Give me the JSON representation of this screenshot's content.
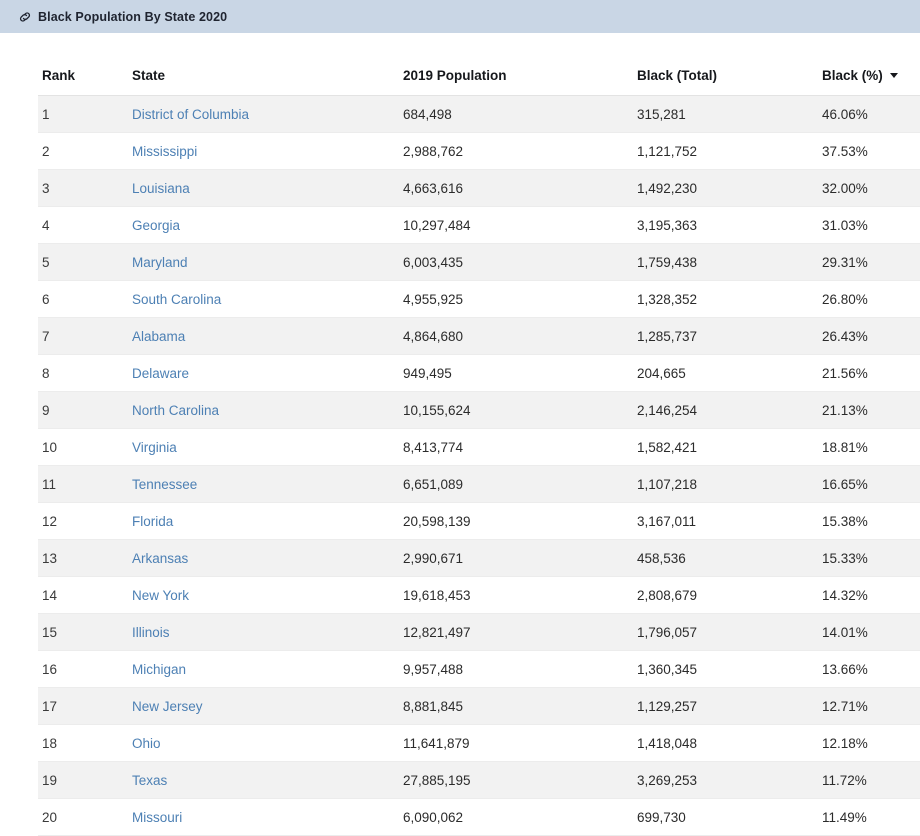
{
  "banner": {
    "icon": "link-icon",
    "title": "Black Population By State 2020",
    "background_color": "#c9d6e5"
  },
  "table": {
    "columns": [
      {
        "key": "rank",
        "label": "Rank",
        "sorted": false
      },
      {
        "key": "state",
        "label": "State",
        "sorted": false
      },
      {
        "key": "pop",
        "label": "2019 Population",
        "sorted": false
      },
      {
        "key": "total",
        "label": "Black (Total)",
        "sorted": false
      },
      {
        "key": "pct",
        "label": "Black (%)",
        "sorted": true,
        "sort_direction": "descending",
        "sort_icon": "caret-down-icon"
      }
    ],
    "link_color": "#4d80b4",
    "row_stripe_color": "#f2f2f2",
    "rows": [
      {
        "rank": "1",
        "state": "District of Columbia",
        "pop": "684,498",
        "total": "315,281",
        "pct": "46.06%"
      },
      {
        "rank": "2",
        "state": "Mississippi",
        "pop": "2,988,762",
        "total": "1,121,752",
        "pct": "37.53%"
      },
      {
        "rank": "3",
        "state": "Louisiana",
        "pop": "4,663,616",
        "total": "1,492,230",
        "pct": "32.00%"
      },
      {
        "rank": "4",
        "state": "Georgia",
        "pop": "10,297,484",
        "total": "3,195,363",
        "pct": "31.03%"
      },
      {
        "rank": "5",
        "state": "Maryland",
        "pop": "6,003,435",
        "total": "1,759,438",
        "pct": "29.31%"
      },
      {
        "rank": "6",
        "state": "South Carolina",
        "pop": "4,955,925",
        "total": "1,328,352",
        "pct": "26.80%"
      },
      {
        "rank": "7",
        "state": "Alabama",
        "pop": "4,864,680",
        "total": "1,285,737",
        "pct": "26.43%"
      },
      {
        "rank": "8",
        "state": "Delaware",
        "pop": "949,495",
        "total": "204,665",
        "pct": "21.56%"
      },
      {
        "rank": "9",
        "state": "North Carolina",
        "pop": "10,155,624",
        "total": "2,146,254",
        "pct": "21.13%"
      },
      {
        "rank": "10",
        "state": "Virginia",
        "pop": "8,413,774",
        "total": "1,582,421",
        "pct": "18.81%"
      },
      {
        "rank": "11",
        "state": "Tennessee",
        "pop": "6,651,089",
        "total": "1,107,218",
        "pct": "16.65%"
      },
      {
        "rank": "12",
        "state": "Florida",
        "pop": "20,598,139",
        "total": "3,167,011",
        "pct": "15.38%"
      },
      {
        "rank": "13",
        "state": "Arkansas",
        "pop": "2,990,671",
        "total": "458,536",
        "pct": "15.33%"
      },
      {
        "rank": "14",
        "state": "New York",
        "pop": "19,618,453",
        "total": "2,808,679",
        "pct": "14.32%"
      },
      {
        "rank": "15",
        "state": "Illinois",
        "pop": "12,821,497",
        "total": "1,796,057",
        "pct": "14.01%"
      },
      {
        "rank": "16",
        "state": "Michigan",
        "pop": "9,957,488",
        "total": "1,360,345",
        "pct": "13.66%"
      },
      {
        "rank": "17",
        "state": "New Jersey",
        "pop": "8,881,845",
        "total": "1,129,257",
        "pct": "12.71%"
      },
      {
        "rank": "18",
        "state": "Ohio",
        "pop": "11,641,879",
        "total": "1,418,048",
        "pct": "12.18%"
      },
      {
        "rank": "19",
        "state": "Texas",
        "pop": "27,885,195",
        "total": "3,269,253",
        "pct": "11.72%"
      },
      {
        "rank": "20",
        "state": "Missouri",
        "pop": "6,090,062",
        "total": "699,730",
        "pct": "11.49%"
      }
    ]
  }
}
